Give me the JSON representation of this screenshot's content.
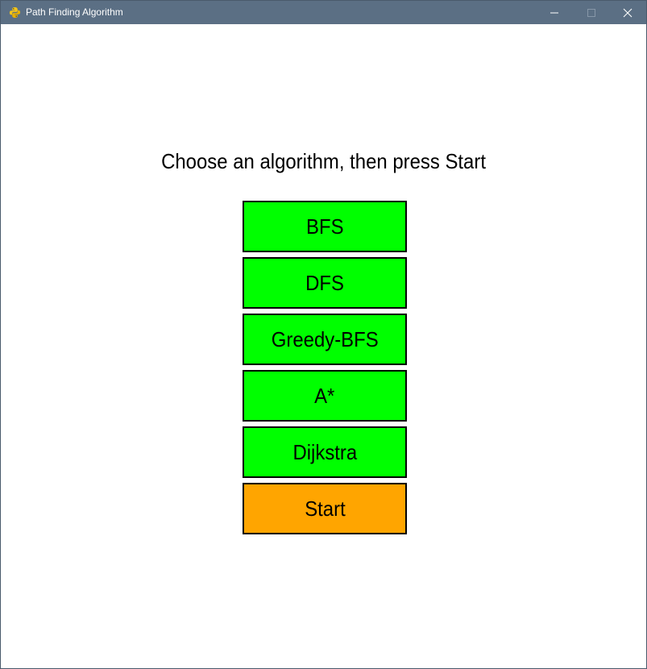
{
  "window": {
    "title": "Path Finding Algorithm",
    "icon": "python-snake-icon",
    "titlebar_color": "#5b6f84"
  },
  "main": {
    "prompt": "Choose an algorithm, then press Start",
    "algorithms": [
      {
        "label": "BFS",
        "color": "#00ff00"
      },
      {
        "label": "DFS",
        "color": "#00ff00"
      },
      {
        "label": "Greedy-BFS",
        "color": "#00ff00"
      },
      {
        "label": "A*",
        "color": "#00ff00"
      },
      {
        "label": "Dijkstra",
        "color": "#00ff00"
      }
    ],
    "start": {
      "label": "Start",
      "color": "#ffa500"
    }
  }
}
